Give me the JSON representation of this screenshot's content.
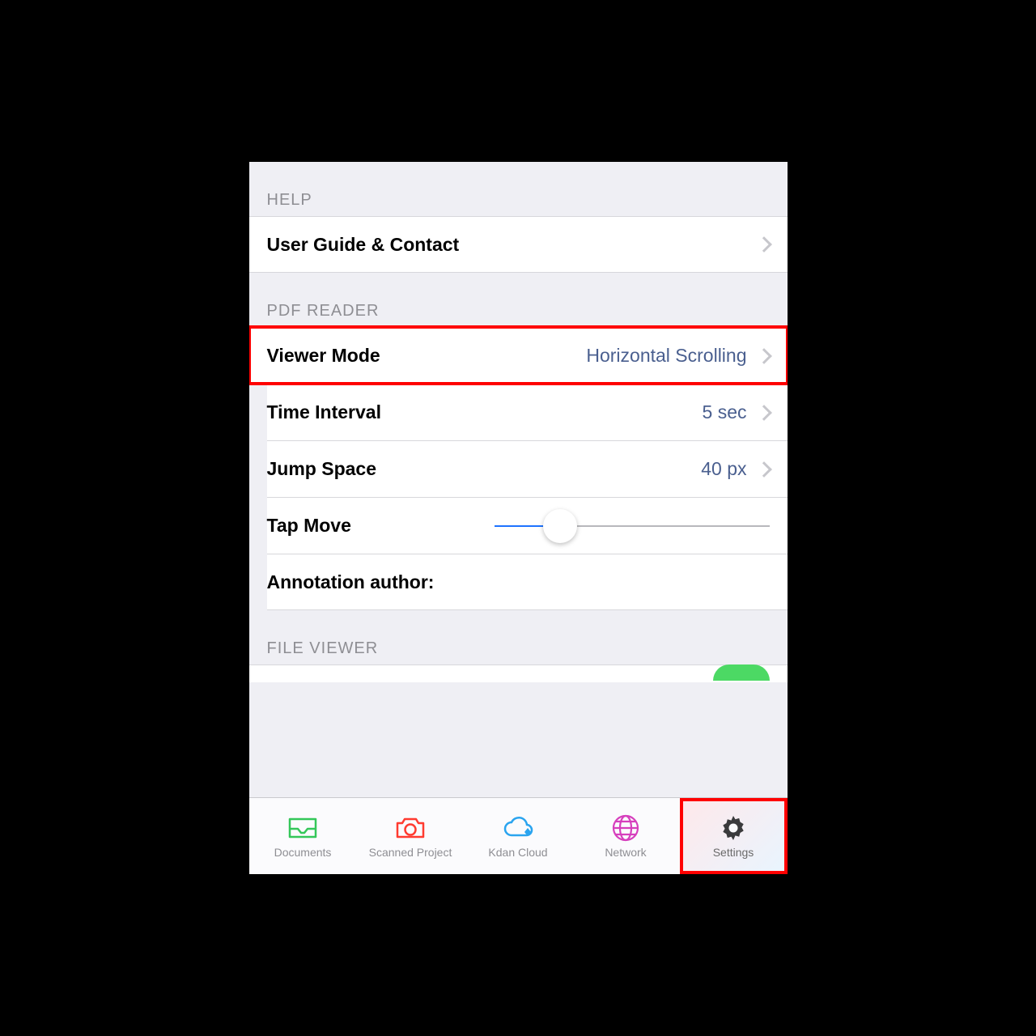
{
  "sections": {
    "help": {
      "header": "HELP",
      "user_guide": {
        "label": "User Guide & Contact"
      }
    },
    "pdf_reader": {
      "header": "PDF READER",
      "viewer_mode": {
        "label": "Viewer Mode",
        "value": "Horizontal Scrolling"
      },
      "time_interval": {
        "label": "Time Interval",
        "value": "5 sec"
      },
      "jump_space": {
        "label": "Jump Space",
        "value": "40 px"
      },
      "tap_move": {
        "label": "Tap Move",
        "slider_percent": 24
      },
      "annotation_author": {
        "label": "Annotation author:"
      }
    },
    "file_viewer": {
      "header": "FILE VIEWER"
    }
  },
  "tabbar": {
    "documents": "Documents",
    "scanned_project": "Scanned Project",
    "kdan_cloud": "Kdan Cloud",
    "network": "Network",
    "settings": "Settings",
    "selected": "settings"
  },
  "colors": {
    "accent_blue": "#1e73ff",
    "value_blue": "#4a5f8f",
    "highlight_red": "#ff0000",
    "toggle_green": "#4cd964",
    "tab_green": "#34c759",
    "tab_red": "#ff3b30",
    "tab_sky": "#2aa4ef",
    "tab_magenta": "#d63fbd",
    "tab_gray": "#3a3a3c"
  }
}
